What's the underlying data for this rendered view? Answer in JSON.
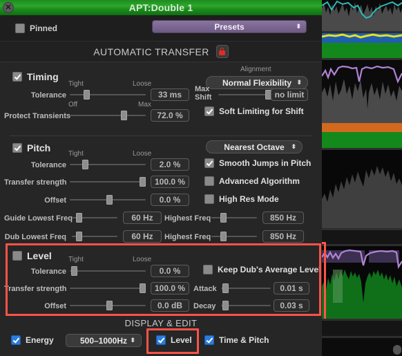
{
  "window": {
    "title": "APT:Double 1",
    "close_icon": "close-icon"
  },
  "toolbar": {
    "pinned_label": "Pinned",
    "pinned_checked": false,
    "presets_label": "Presets",
    "presets_icon": "up-down-arrows-icon"
  },
  "automatic_transfer": {
    "title": "AUTOMATIC TRANSFER",
    "lock_icon": "lock-icon"
  },
  "timing": {
    "enabled_label": "Timing",
    "alignment_caption": "Alignment",
    "alignment_value": "Normal Flexibility",
    "tolerance_label": "Tolerance",
    "tolerance_min": "Tight",
    "tolerance_max": "Loose",
    "tolerance_value": "33 ms",
    "max_shift_label_line1": "Max",
    "max_shift_label_line2": "Shift",
    "max_shift_value": "no limit",
    "protect_label": "Protect Transients",
    "protect_min": "Off",
    "protect_max": "Max",
    "protect_value": "72.0 %",
    "soft_limiting_label": "Soft Limiting for Shift"
  },
  "pitch": {
    "enabled_label": "Pitch",
    "mode_value": "Nearest Octave",
    "tolerance_label": "Tolerance",
    "tolerance_min": "Tight",
    "tolerance_max": "Loose",
    "tolerance_value": "2.0 %",
    "smooth_jumps_label": "Smooth Jumps in Pitch",
    "transfer_label": "Transfer strength",
    "transfer_value": "100.0 %",
    "advanced_label": "Advanced Algorithm",
    "offset_label": "Offset",
    "offset_value": "0.0 %",
    "high_res_label": "High Res Mode",
    "guide_lowest_label": "Guide Lowest Freq",
    "guide_lowest_value": "60 Hz",
    "guide_highest_label": "Highest Freq",
    "guide_highest_value": "850 Hz",
    "dub_lowest_label": "Dub Lowest Freq",
    "dub_lowest_value": "60 Hz",
    "dub_highest_label": "Highest Freq",
    "dub_highest_value": "850 Hz"
  },
  "level": {
    "enabled_label": "Level",
    "tolerance_label": "Tolerance",
    "tolerance_min": "Tight",
    "tolerance_max": "Loose",
    "tolerance_value": "0.0 %",
    "keep_avg_label": "Keep Dub's Average Level",
    "transfer_label": "Transfer strength",
    "transfer_value": "100.0 %",
    "attack_label": "Attack",
    "attack_value": "0.01 s",
    "offset_label": "Offset",
    "offset_value": "0.0 dB",
    "decay_label": "Decay",
    "decay_value": "0.03 s"
  },
  "display_edit": {
    "title": "DISPLAY & EDIT",
    "energy_label": "Energy",
    "band_value": "500–1000Hz",
    "level_label": "Level",
    "time_pitch_label": "Time & Pitch"
  },
  "colors": {
    "accent_highlight": "#ff5348",
    "titlebar_green": "#2aa82a",
    "presets_purple": "#7b6791",
    "checkbox_blue": "#2a7de1",
    "lock_red": "#e22b22"
  }
}
